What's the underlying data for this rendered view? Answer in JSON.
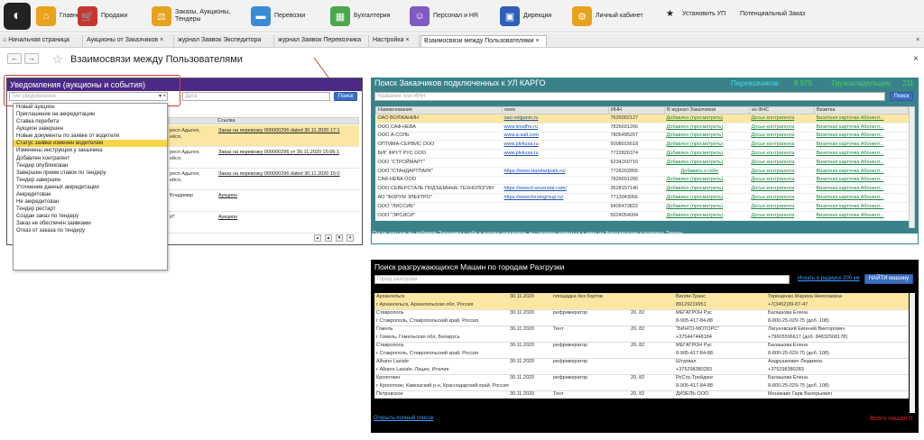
{
  "colors": {
    "accent": "#4b2a86",
    "teal": "#39828a",
    "black": "#000000",
    "highlight": "#f7d44c",
    "arrow": "#d93a3a"
  },
  "topbar": {
    "sections": [
      {
        "label": "Главное",
        "icon": "home-icon",
        "color": "#e9a21c"
      },
      {
        "label": "Продажи",
        "icon": "cart-icon",
        "color": "#c8352f"
      },
      {
        "label": "Заказы, Аукционы, Тендеры",
        "icon": "gavel-icon",
        "color": "#e9a21c"
      },
      {
        "label": "Перевозки",
        "icon": "truck-icon",
        "color": "#3a8ad6"
      },
      {
        "label": "Бухгалтерия",
        "icon": "calculator-icon",
        "color": "#4aa84a"
      },
      {
        "label": "Персонал и HR",
        "icon": "people-icon",
        "color": "#7e5bc2"
      },
      {
        "label": "Дирекция",
        "icon": "briefcase-icon",
        "color": "#2d5fb8"
      },
      {
        "label": "Личный кабинет",
        "icon": "gear-icon",
        "color": "#e9a21c"
      }
    ],
    "right": [
      "Установить УП",
      "Потенциальный Заказ"
    ]
  },
  "tabs": [
    "Начальная страница",
    "Аукционы от Заказчиков",
    "журнал Заявок Экспедитора",
    "журнал Заявок Перевозчика",
    "Настройка",
    "Взаимосвязи между Пользователями"
  ],
  "page": {
    "title": "Взаимосвязи между Пользователями"
  },
  "notifications": {
    "title": "Уведомления (аукционы и события)",
    "type_placeholder": "Тип уведомления",
    "date_placeholder": "Дата",
    "search_button": "Поиск",
    "col_link": "Ссылка",
    "rows": [
      {
        "addr": "респ Адыгея,",
        "addr2": "ейся,",
        "link": "Заказ на перевозку 000000296 dated 30.11.2020 17:1"
      },
      {
        "addr": "респ Адыгея,",
        "addr2": "ейся,",
        "link": "Заказ на перевозку 000000296 от 30.11.2020 15:06:1"
      },
      {
        "addr": "респ Адыгея,",
        "addr2": "ейся,",
        "link": "Заказ на перевозку 000000296 dated 30.11.2020 15:0"
      },
      {
        "addr": "Владимир",
        "addr2": "",
        "link": "Аукцион"
      },
      {
        "addr": "И\"",
        "addr2": "",
        "link": "Аукцион"
      }
    ],
    "dropdown": [
      "Новый аукцион",
      "Приглашение на аккредитацию",
      "Ставка перебита",
      "Аукцион завершен",
      "Новые документы по заявке от водителя",
      "Статус заявки изменен водителем",
      "Изменены инструкции у заказчика",
      "Добавлен контрагент",
      "Тендер опубликован",
      "Завершен прием ставок по тендеру",
      "Тендер завершен",
      "Уточнение данных аккредитации",
      "Аккредитован",
      "Не аккредитован",
      "Тендер рестарт",
      "Создан заказ по тендеру",
      "Заказ не обеспечен заявками",
      "Отказ от заказа по тендеру"
    ],
    "dropdown_selected": 5
  },
  "customers": {
    "title": "Поиск Заказчиков подключенных к УЛ КАРГО",
    "stat1_label": "Перевозчиков:",
    "stat1_value": "8 975",
    "stat2_label": "Грузовладельцев:",
    "stat2_value": "211",
    "placeholder": "Название или ИНН",
    "search_button": "Поиск",
    "headers": [
      "Наименование",
      "www",
      "ИНН",
      "В журнал Заказчиков",
      "из ФНС",
      "Визитка"
    ],
    "rows": [
      {
        "name": "ОАО ВОЛЖАНИН",
        "www": "oao-volganin.ru",
        "inn": "7626002127",
        "journal": "Добавлен (просмотреть)",
        "fns": "Досье контрагента",
        "card": "Визитная карточка Абонент..."
      },
      {
        "name": "ООО САФ-НЕВА",
        "www": "www.lesaffre.ru",
        "inn": "7826691266",
        "journal": "Добавлен (просмотреть)",
        "fns": "Досье контрагента",
        "card": "Визитная карточка Абонент..."
      },
      {
        "name": "ООО А-СОЛЬ",
        "www": "www.a-salt.com",
        "inn": "7805495207",
        "journal": "Добавлен (просмотреть)",
        "fns": "Досье контрагента",
        "card": "Визитная карточка Абонент..."
      },
      {
        "name": "ОПТИМА-СЕРВИС ООО",
        "www": "www.plvkusa.ru",
        "inn": "5008015618",
        "journal": "Добавлен (просмотреть)",
        "fns": "Досье контрагента",
        "card": "Визитная карточка Абонент..."
      },
      {
        "name": "БИГ ФРУТ РУС ООО",
        "www": "www.plvkusa.ru",
        "inn": "7722826374",
        "journal": "Добавлен (просмотреть)",
        "fns": "Досье контрагента",
        "card": "Визитная карточка Абонент..."
      },
      {
        "name": "ООО \"СТРОЙМАРТ\"",
        "www": "",
        "inn": "6234160716",
        "journal": "Добавлен (просмотреть)",
        "fns": "Досье контрагента",
        "card": "Визитная карточка Абонент..."
      },
      {
        "name": "ООО \"СТАНДАРТПАРК\"",
        "www": "https://www.standartpark.ru/",
        "inn": "7728202855",
        "journal": "Добавить к себе",
        "fns": "Досье контрагента",
        "card": "Визитная карточка Абонент..."
      },
      {
        "name": "САФ-НЕВА ООО",
        "www": "",
        "inn": "7826691266",
        "journal": "Добавлен (просмотреть)",
        "fns": "Досье контрагента",
        "card": "Визитная карточка Абонент..."
      },
      {
        "name": "ООО СЕВЕРСТАЛЬ ПОДЪЕМНЫЕ ТЕХНОЛОГИИ",
        "www": "https://www.lt.severstal.com/",
        "inn": "3528157140",
        "journal": "Добавлен (просмотреть)",
        "fns": "Досье контрагента",
        "card": "Визитная карточка Абонент..."
      },
      {
        "name": "АО \"ФОРУМ ЭЛЕКТРО\"",
        "www": "https://www.forumgroup.ru/",
        "inn": "7713043056",
        "journal": "Добавлен (просмотреть)",
        "fns": "Досье контрагента",
        "card": "Визитная карточка Абонент..."
      },
      {
        "name": "ООО \"ЛИССИБ\"",
        "www": "",
        "inn": "5405473822",
        "journal": "Добавлен (просмотреть)",
        "fns": "Досье контрагента",
        "card": "Визитная карточка Абонент..."
      },
      {
        "name": "ООО \"ЭРСИСИ\"",
        "www": "",
        "inn": "5024054004",
        "journal": "Добавлен (просмотреть)",
        "fns": "Досье контрагента",
        "card": "Визитная карточка Абонент..."
      }
    ],
    "footer1": "После того как вы добавите Заказчика к себе в журнал заказчиков, вы сможете заявиться к нему на Аккредитацию и получать Заказы.",
    "footer2": "С этими Заказчиками вы сможете обмениваться заявками по ЭВТ обмену"
  },
  "trucks": {
    "title": "Поиск разгружающихся Машин по городам Разгрузки",
    "placeholder": "Город разгрузки",
    "radius_link": "Искать в радиусе 200 км",
    "find_button": "НАЙТИ машину",
    "rows": [
      {
        "city": "Архангельск",
        "date": "30.11.2020",
        "type": "площадка без бортов",
        "load": "",
        "co": "Вилли-Транс",
        "person": "Терещенко Марина Николаевна",
        "addr": "г Архангельск,  Архангельская обл, Россия",
        "phone": "89129219951",
        "phone2": "+7(3452)39-87-47"
      },
      {
        "city": "Ставрополь",
        "date": "30.11.2020",
        "type": "рефрижератор",
        "load": "20, 82",
        "co": "МЕГАТРОН Рус",
        "person": "Балашова Елена",
        "addr": "г Ставрополь,  Ставропольский край, Россия",
        "phone": "8-905-417-84-88",
        "phone2": "8-800-25-029-75 (доб. 108)"
      },
      {
        "city": "Гомель",
        "date": "30.11.2020",
        "type": "Тент",
        "load": "20, 82",
        "co": "\"БИНГО-МОТОРС\"",
        "person": "Лагуновский Евгений Викторович",
        "addr": "г Гомель,  Гомельская обл, Беларусь",
        "phone": "+375447448184",
        "phone2": "+79605596617 (доб. 84832508178)"
      },
      {
        "city": "Ставрополь",
        "date": "30.11.2020",
        "type": "рефрижератор",
        "load": "20, 82",
        "co": "МЕГАТРОН Рус",
        "person": "Балашова Елена",
        "addr": "г Ставрополь,  Ставропольский край, Россия",
        "phone": "8-905-417-84-88",
        "phone2": "8-800-25-029-75 (доб. 108)"
      },
      {
        "city": "Albano Laziale",
        "date": "30.11.2020",
        "type": "рефрижератор",
        "load": "",
        "co": "Штурвал",
        "person": "Андрушкевич Людмила",
        "addr": "г Albano Laziale,  Лацио, Италия",
        "phone": "+375298380283",
        "phone2": "+375298380283"
      },
      {
        "city": "Кропоткин",
        "date": "30.11.2020",
        "type": "рефрижератор",
        "load": "20, 82",
        "co": "РоСтр-Трейдинг",
        "person": "Балашова Елена",
        "addr": "г Кропоткин,  Кавказский р-н,  Краснодарский край, Россия",
        "phone": "8-905-417-84-88",
        "phone2": "8-800-25-029-75 (доб. 108)"
      },
      {
        "city": "Петровское",
        "date": "30.11.2020",
        "type": "Тент",
        "load": "20, 82",
        "co": "ДИЗЕЛЬ ООО",
        "person": "Моникаве Гарв Валерьевич",
        "addr": "",
        "phone": "",
        "phone2": ""
      }
    ],
    "open_list": "Открыть полный список",
    "total": "Всего нашин:0"
  }
}
